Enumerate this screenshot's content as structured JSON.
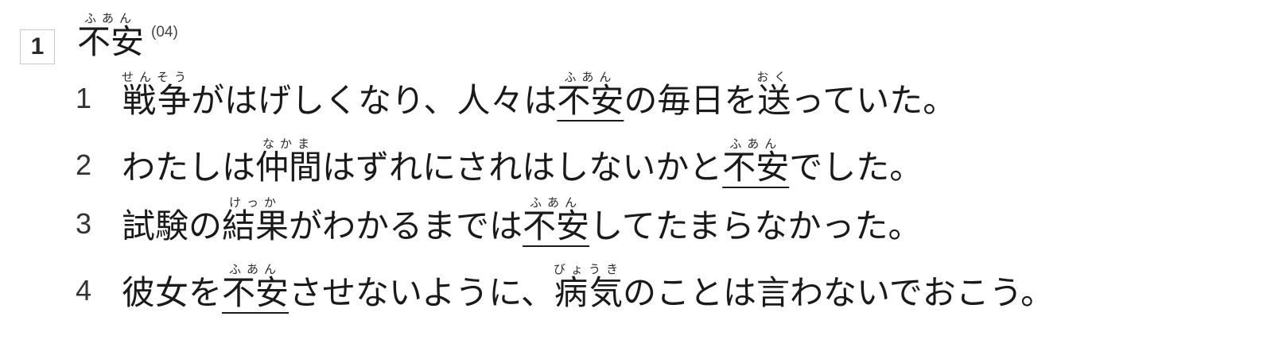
{
  "question": {
    "number": "1",
    "keyword": "不安",
    "keyword_reading": "ふあん",
    "code": "(04)"
  },
  "options": [
    {
      "number": "1",
      "segments": [
        {
          "text": "戦争",
          "ruby": "せんそう"
        },
        {
          "text": "がはげしくなり、人々は"
        },
        {
          "text": "不安",
          "ruby": "ふあん",
          "underline": true
        },
        {
          "text": "の毎日を"
        },
        {
          "text": "送",
          "ruby": "おく"
        },
        {
          "text": "っていた。"
        }
      ]
    },
    {
      "number": "2",
      "segments": [
        {
          "text": "わたしは"
        },
        {
          "text": "仲間",
          "ruby": "なかま"
        },
        {
          "text": "はずれにされはしないかと"
        },
        {
          "text": "不安",
          "ruby": "ふあん",
          "underline": true
        },
        {
          "text": "でした。"
        }
      ]
    },
    {
      "number": "3",
      "segments": [
        {
          "text": "試験の"
        },
        {
          "text": "結果",
          "ruby": "けっか"
        },
        {
          "text": "がわかるまでは"
        },
        {
          "text": "不安",
          "ruby": "ふあん",
          "underline": true
        },
        {
          "text": "してたまらなかった。"
        }
      ]
    },
    {
      "number": "4",
      "segments": [
        {
          "text": "彼女を"
        },
        {
          "text": "不安",
          "ruby": "ふあん",
          "underline": true
        },
        {
          "text": "させないように、"
        },
        {
          "text": "病気",
          "ruby": "びょうき"
        },
        {
          "text": "のことは言わないでおこう。"
        }
      ]
    }
  ]
}
